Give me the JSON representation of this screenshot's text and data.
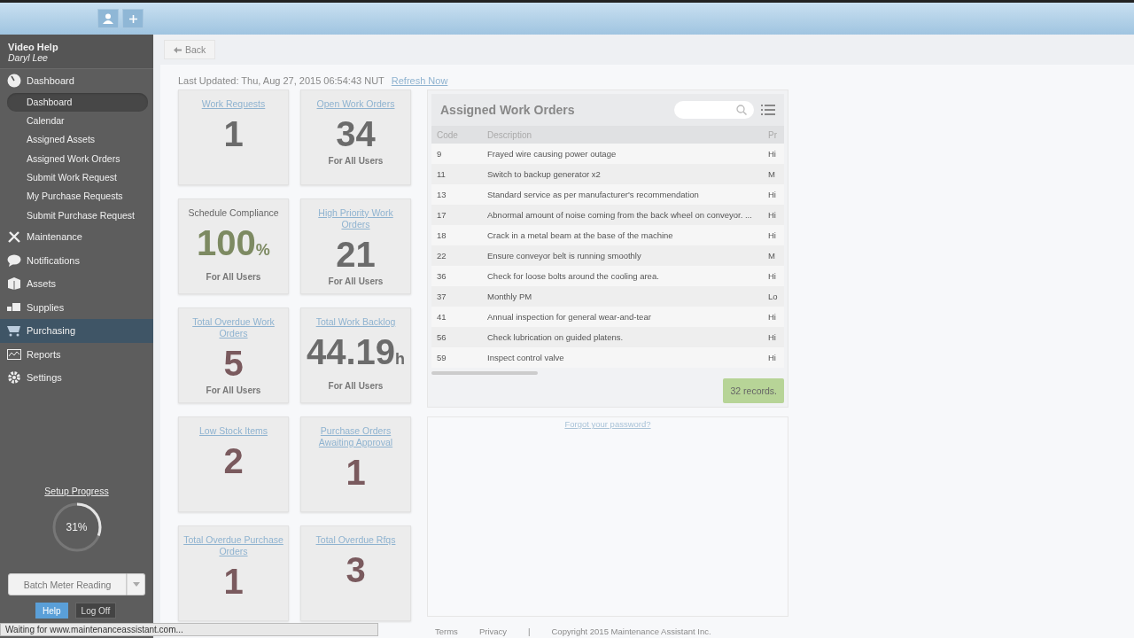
{
  "sidebar": {
    "account": "Video Help",
    "user": "Daryl Lee",
    "items": [
      {
        "label": "Dashboard",
        "selected": false,
        "expanded": true,
        "children": [
          {
            "label": "Dashboard",
            "selected": true
          },
          {
            "label": "Calendar",
            "selected": false
          },
          {
            "label": "Assigned Assets",
            "selected": false
          },
          {
            "label": "Assigned Work Orders",
            "selected": false
          },
          {
            "label": "Submit Work Request",
            "selected": false
          },
          {
            "label": "My Purchase Requests",
            "selected": false
          },
          {
            "label": "Submit Purchase Request",
            "selected": false
          }
        ]
      },
      {
        "label": "Maintenance",
        "selected": false
      },
      {
        "label": "Notifications",
        "selected": false
      },
      {
        "label": "Assets",
        "selected": false
      },
      {
        "label": "Supplies",
        "selected": false
      },
      {
        "label": "Purchasing",
        "selected": true
      },
      {
        "label": "Reports",
        "selected": false
      },
      {
        "label": "Settings",
        "selected": false
      }
    ],
    "setup": {
      "label": "Setup Progress",
      "reading": "31%",
      "level": 0.31
    },
    "batch_button": "Batch Meter Reading",
    "help_button": "Help",
    "logoff_button": "Log Off"
  },
  "back_button": "Back",
  "last_updated": "Last Updated: Thu, Aug 27, 2015 06:54:43 NUT",
  "refresh_link": "Refresh Now",
  "tiles": [
    {
      "title": "Work Requests",
      "link": true,
      "value": "1",
      "color": "#6b6b6b"
    },
    {
      "title": "Open Work Orders",
      "link": true,
      "value": "34",
      "footer": "For All Users",
      "color": "#6b6b6b"
    },
    {
      "title": "Schedule Compliance",
      "link": false,
      "value": "100",
      "unit": "%",
      "footer": "For All Users",
      "color": "#7d8a62"
    },
    {
      "title": "High Priority Work Orders",
      "link": true,
      "value": "21",
      "footer": "For All Users",
      "color": "#6b6b6b"
    },
    {
      "title": "Total Overdue Work Orders",
      "link": true,
      "value": "5",
      "footer": "For All Users",
      "color": "#7a5a5e"
    },
    {
      "title": "Total Work Backlog",
      "link": true,
      "value": "44.19",
      "unit": "h",
      "footer": "For All Users",
      "color": "#6b6b6b"
    },
    {
      "title": "Low Stock Items",
      "link": true,
      "value": "2",
      "color": "#7a5a5e"
    },
    {
      "title": "Purchase Orders Awaiting Approval",
      "link": true,
      "value": "1",
      "color": "#7a5a5e"
    },
    {
      "title": "Total Overdue Purchase Orders",
      "link": true,
      "value": "1",
      "color": "#7a5a5e"
    },
    {
      "title": "Total Overdue Rfqs",
      "link": true,
      "value": "3",
      "color": "#7a5a5e"
    }
  ],
  "work_orders": {
    "title": "Assigned Work Orders",
    "columns": [
      "Code",
      "Description",
      "Pr"
    ],
    "rows": [
      [
        "9",
        "Frayed wire causing power outage",
        "Hi"
      ],
      [
        "11",
        "Switch to backup generator x2",
        "M"
      ],
      [
        "13",
        "Standard service as per manufacturer's recommendation",
        "Hi"
      ],
      [
        "17",
        "Abnormal amount of noise coming from the back wheel on conveyor. ...",
        "Hi"
      ],
      [
        "18",
        "Crack in a metal beam at the base of the machine",
        "Hi"
      ],
      [
        "22",
        "Ensure conveyor belt is running smoothly",
        "M"
      ],
      [
        "36",
        "Check for loose bolts around the cooling area.",
        "Hi"
      ],
      [
        "37",
        "Monthly PM",
        "Lo"
      ],
      [
        "41",
        "Annual inspection for general wear-and-tear",
        "Hi"
      ],
      [
        "56",
        "Check lubrication on guided platens.",
        "Hi"
      ],
      [
        "59",
        "Inspect control valve",
        "Hi"
      ]
    ],
    "records": "32 records."
  },
  "forgot_link": "Forgot your password?",
  "footer": {
    "terms": "Terms",
    "privacy": "Privacy",
    "separator": "|",
    "copyright": "Copyright 2015 Maintenance Assistant Inc."
  },
  "status_bar": "Waiting for www.maintenanceassistant.com..."
}
